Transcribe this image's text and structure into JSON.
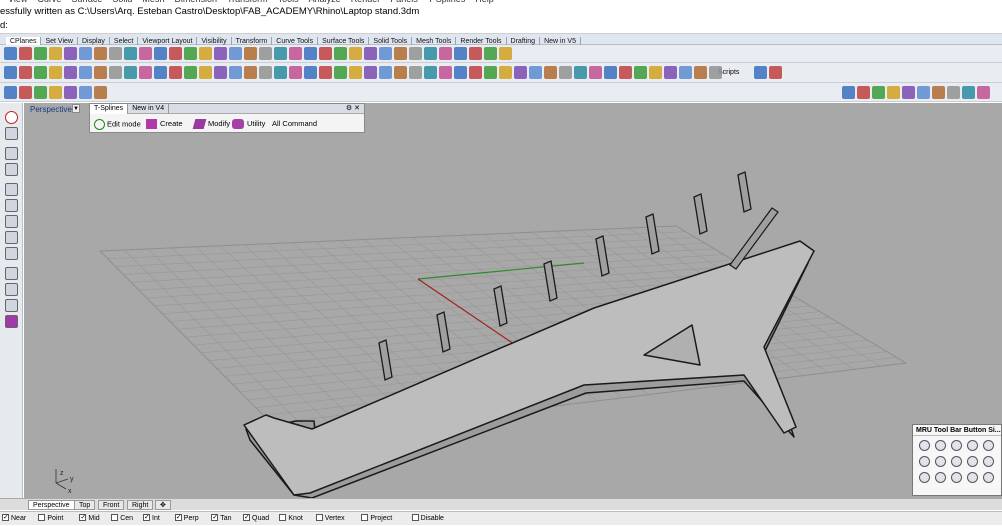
{
  "menu": [
    "View",
    "Curve",
    "Surface",
    "Solid",
    "Mesh",
    "Dimension",
    "Transform",
    "Tools",
    "Analyze",
    "Render",
    "Panels",
    "T-Splines",
    "Help"
  ],
  "command_history": "essfully written as C:\\Users\\Arq. Esteban Castro\\Desktop\\FAB_ACADEMY\\Rhino\\Laptop stand.3dm",
  "command_prompt": "d:",
  "toolbar_tabs": [
    "CPlanes",
    "Set View",
    "Display",
    "Select",
    "Viewport Layout",
    "Visibility",
    "Transform",
    "Curve Tools",
    "Surface Tools",
    "Solid Tools",
    "Mesh Tools",
    "Render Tools",
    "Drafting",
    "New in V5"
  ],
  "toolbar_scripts_label": "Scripts",
  "viewport": {
    "label": "Perspective"
  },
  "tsplines_panel": {
    "tabs": [
      "T-Splines",
      "New in V4"
    ],
    "items": [
      {
        "icon": "power-icon",
        "label": "Edit mode"
      },
      {
        "icon": "create-box-icon",
        "label": "Create"
      },
      {
        "icon": "modify-icon",
        "label": "Modify"
      },
      {
        "icon": "utility-icon",
        "label": "Utility"
      },
      {
        "icon": "",
        "label": "All Command"
      }
    ]
  },
  "mru_panel": {
    "title": "MRU Tool Bar Button Si..."
  },
  "view_tabs": [
    "Perspective",
    "Top",
    "Front",
    "Right"
  ],
  "osnaps": [
    {
      "label": "Near",
      "checked": true
    },
    {
      "label": "Point",
      "checked": false
    },
    {
      "label": "Mid",
      "checked": true
    },
    {
      "label": "Cen",
      "checked": false
    },
    {
      "label": "Int",
      "checked": true
    },
    {
      "label": "Perp",
      "checked": true
    },
    {
      "label": "Tan",
      "checked": true
    },
    {
      "label": "Quad",
      "checked": true
    },
    {
      "label": "Knot",
      "checked": false
    },
    {
      "label": "Vertex",
      "checked": false
    },
    {
      "label": "Project",
      "checked": false
    },
    {
      "label": "Disable",
      "checked": false
    }
  ],
  "axis_labels": {
    "z": "z",
    "y": "y",
    "x": "x"
  }
}
